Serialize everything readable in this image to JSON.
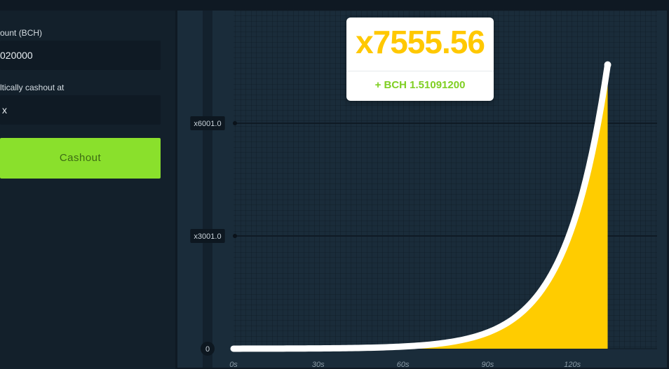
{
  "bet_panel": {
    "amount_label": "ount (BCH)",
    "amount_value": "020000",
    "auto_cashout_label": "ltically cashout at",
    "auto_cashout_value": "x",
    "cashout_button_label": "Cashout"
  },
  "tooltip": {
    "multiplier": "x7555.56",
    "profit": "+ BCH 1.51091200"
  },
  "colors": {
    "accent_green": "#8ae02c",
    "curve_fill": "#ffcc00",
    "curve_line": "#ffffff",
    "multiplier_text": "#ffc800"
  },
  "chart_data": {
    "type": "area",
    "y_ticks": [
      {
        "value": 0,
        "label": "0"
      },
      {
        "value": 3001,
        "label": "x3001.0"
      },
      {
        "value": 6001,
        "label": "x6001.0"
      }
    ],
    "x_ticks": [
      {
        "value": 0,
        "label": "0s"
      },
      {
        "value": 30,
        "label": "30s"
      },
      {
        "value": 60,
        "label": "60s"
      },
      {
        "value": 90,
        "label": "90s"
      },
      {
        "value": 120,
        "label": "120s"
      }
    ],
    "xlim": [
      0,
      150
    ],
    "ylim": [
      0,
      9000
    ],
    "current_time": 132.5,
    "current_multiplier": 7555.56,
    "grid": true
  }
}
